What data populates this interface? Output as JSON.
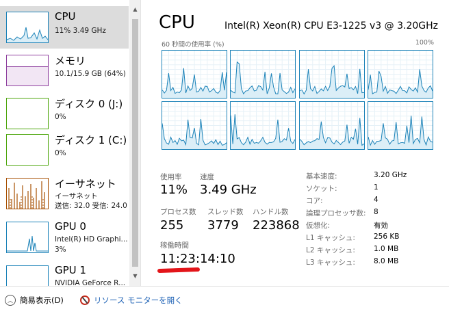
{
  "sidebar": {
    "items": [
      {
        "title": "CPU",
        "sub1": "11%  3.49 GHz",
        "sub2": "",
        "sub3": "",
        "color": "#1b82b8"
      },
      {
        "title": "メモリ",
        "sub1": "10.1/15.9 GB (64%)",
        "sub2": "",
        "sub3": "",
        "color": "#8e3f9e"
      },
      {
        "title": "ディスク 0 (J:)",
        "sub1": "0%",
        "sub2": "",
        "sub3": "",
        "color": "#4da60c"
      },
      {
        "title": "ディスク 1 (C:)",
        "sub1": "0%",
        "sub2": "",
        "sub3": "",
        "color": "#4da60c"
      },
      {
        "title": "イーサネット",
        "sub1": "イーサネット",
        "sub2": "送信: 32.0 受信: 24.0",
        "sub3": "",
        "color": "#a74f01"
      },
      {
        "title": "GPU 0",
        "sub1": "Intel(R) HD Graphi...",
        "sub2": "3%",
        "sub3": "",
        "color": "#1b82b8"
      },
      {
        "title": "GPU 1",
        "sub1": "NVIDIA GeForce R...",
        "sub2": "",
        "sub3": "",
        "color": "#1b82b8"
      }
    ]
  },
  "main": {
    "title": "CPU",
    "model": "Intel(R) Xeon(R) CPU E3-1225 v3 @ 3.20GHz",
    "graph_label_left": "60 秒間の使用率 (%)",
    "graph_label_right": "100%",
    "stats": {
      "utilization_label": "使用率",
      "utilization_value": "11%",
      "speed_label": "速度",
      "speed_value": "3.49 GHz",
      "processes_label": "プロセス数",
      "processes_value": "255",
      "threads_label": "スレッド数",
      "threads_value": "3779",
      "handles_label": "ハンドル数",
      "handles_value": "223868",
      "uptime_label": "稼働時間",
      "uptime_value": "11:23:14:10"
    },
    "specs": [
      {
        "label": "基本速度:",
        "value": "3.20 GHz"
      },
      {
        "label": "ソケット:",
        "value": "1"
      },
      {
        "label": "コア:",
        "value": "4"
      },
      {
        "label": "論理プロセッサ数:",
        "value": "8"
      },
      {
        "label": "仮想化:",
        "value": "有効"
      },
      {
        "label": "L1 キャッシュ:",
        "value": "256 KB"
      },
      {
        "label": "L2 キャッシュ:",
        "value": "1.0 MB"
      },
      {
        "label": "L3 キャッシュ:",
        "value": "8.0 MB"
      }
    ]
  },
  "footer": {
    "fewer_details": "簡易表示(D)",
    "resource_monitor": "リソース モニターを開く"
  },
  "colors": {
    "cpu_accent": "#1b82b8",
    "memory_accent": "#8e3f9e",
    "disk_accent": "#4da60c",
    "network_accent": "#a74f01",
    "annotation_red": "#e3151a"
  }
}
